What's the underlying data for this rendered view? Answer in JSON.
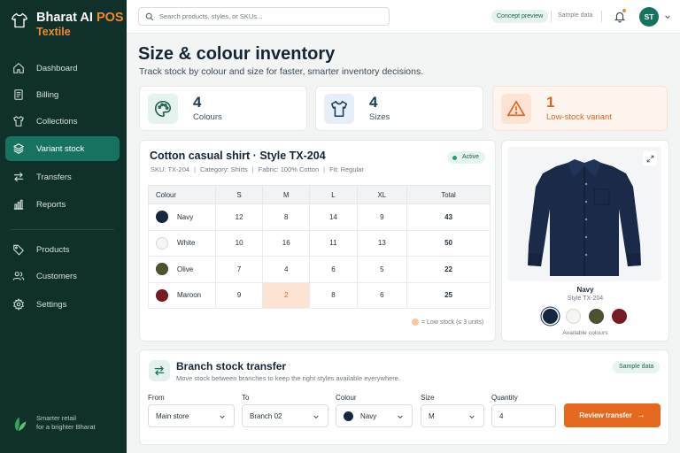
{
  "brand": {
    "name_part1": "Bharat AI",
    "name_part2": "POS",
    "subtitle": "Textile"
  },
  "sidebar": {
    "items": [
      {
        "label": "Dashboard",
        "icon": "home-icon"
      },
      {
        "label": "Billing",
        "icon": "receipt-icon"
      },
      {
        "label": "Collections",
        "icon": "shirt-icon"
      },
      {
        "label": "Variant stock",
        "icon": "layers-icon",
        "active": true
      },
      {
        "label": "Transfers",
        "icon": "transfer-icon"
      },
      {
        "label": "Reports",
        "icon": "bar-chart-icon"
      },
      {
        "label": "Products",
        "icon": "tag-icon"
      },
      {
        "label": "Customers",
        "icon": "users-icon"
      },
      {
        "label": "Settings",
        "icon": "gear-icon"
      }
    ],
    "footer": {
      "line1": "Smarter retail",
      "line2": "for a brighter Bharat"
    }
  },
  "topbar": {
    "search_placeholder": "Search products, styles, or SKUs...",
    "concept_badge": "Concept preview",
    "sample_label": "Sample data",
    "avatar_initials": "ST"
  },
  "header": {
    "title": "Size & colour inventory",
    "subtitle": "Track stock by colour and size for faster, smarter inventory decisions."
  },
  "stats": [
    {
      "value": "4",
      "label": "Colours",
      "icon": "palette-icon"
    },
    {
      "value": "4",
      "label": "Sizes",
      "icon": "shirt-icon"
    },
    {
      "value": "1",
      "label": "Low-stock variant",
      "icon": "warning-icon"
    }
  ],
  "product": {
    "title": "Cotton casual shirt · Style TX-204",
    "sku": "SKU: TX-204",
    "category": "Category: Shirts",
    "fabric": "Fabric: 100% Cotton",
    "fit": "Fit: Regular",
    "status": "Active",
    "table": {
      "headers": [
        "Colour",
        "S",
        "M",
        "L",
        "XL",
        "Total"
      ],
      "rows": [
        {
          "colour": "Navy",
          "swatch": "#16283f",
          "s": "12",
          "m": "8",
          "l": "14",
          "xl": "9",
          "total": "43"
        },
        {
          "colour": "White",
          "swatch": "#f6f6f4",
          "s": "10",
          "m": "16",
          "l": "11",
          "xl": "13",
          "total": "50"
        },
        {
          "colour": "Olive",
          "swatch": "#4c5331",
          "s": "7",
          "m": "4",
          "l": "6",
          "xl": "5",
          "total": "22"
        },
        {
          "colour": "Maroon",
          "swatch": "#7a1a24",
          "s": "9",
          "m": "2",
          "l": "8",
          "xl": "6",
          "total": "25",
          "low": "m"
        }
      ]
    },
    "legend": "= Low stock (≤ 3 units)"
  },
  "preview": {
    "name": "Navy",
    "style": "Style TX-204",
    "swatches": [
      "#16283f",
      "#f6f6f4",
      "#4c5331",
      "#7a1a24"
    ],
    "available_label": "Available colours"
  },
  "transfer": {
    "title": "Branch stock transfer",
    "subtitle": "Move stock between branches to keep the right styles available everywhere.",
    "sample_label": "Sample data",
    "fields": {
      "from": {
        "label": "From",
        "value": "Main store"
      },
      "to": {
        "label": "To",
        "value": "Branch 02"
      },
      "colour": {
        "label": "Colour",
        "value": "Navy"
      },
      "size": {
        "label": "Size",
        "value": "M"
      },
      "quantity": {
        "label": "Quantity",
        "value": "4"
      }
    },
    "button": "Review transfer"
  },
  "colors": {
    "sidebar_bg": "#10302a",
    "accent_green": "#17735f",
    "accent_orange": "#e5681f"
  }
}
